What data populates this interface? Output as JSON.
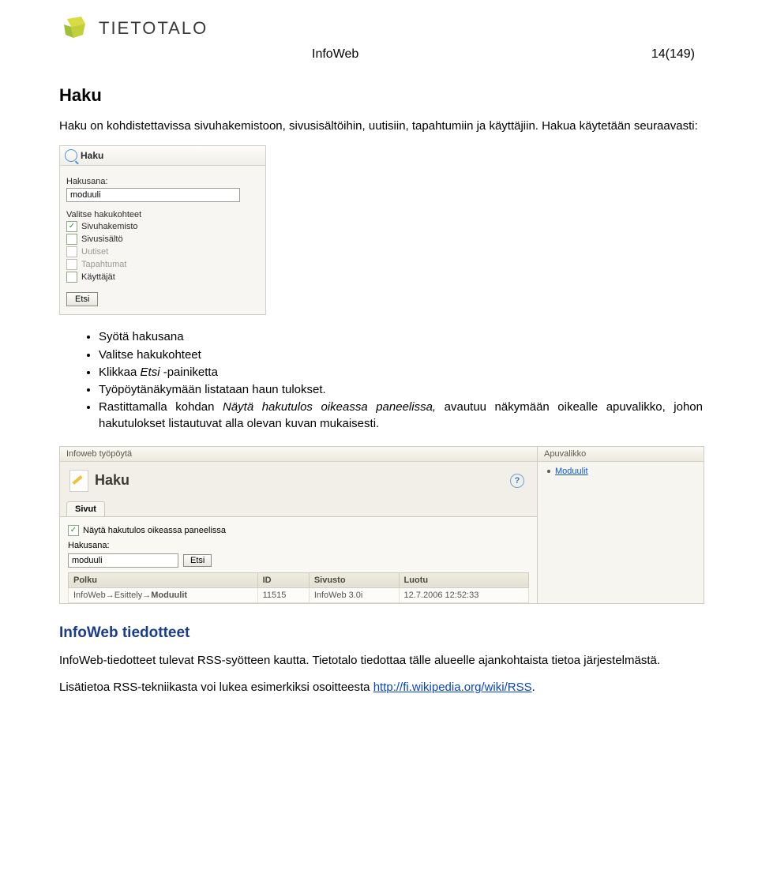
{
  "logo_text": "TIETOTALO",
  "doc_title": "InfoWeb",
  "page_no": "14(149)",
  "h_haku": "Haku",
  "p_intro": "Haku on kohdistettavissa sivuhakemistoon, sivusisältöihin, uutisiin, tapahtumiin ja käyttäjiin. Hakua käytetään seuraavasti:",
  "inset1": {
    "title": "Haku",
    "lbl_hakusana": "Hakusana:",
    "val_hakusana": "moduuli",
    "lbl_valitse": "Valitse hakukohteet",
    "opts": [
      {
        "label": "Sivuhakemisto",
        "checked": true,
        "dim": false
      },
      {
        "label": "Sivusisältö",
        "checked": false,
        "dim": false
      },
      {
        "label": "Uutiset",
        "checked": false,
        "dim": true
      },
      {
        "label": "Tapahtumat",
        "checked": false,
        "dim": true
      },
      {
        "label": "Käyttäjät",
        "checked": false,
        "dim": false
      }
    ],
    "btn_etsi": "Etsi"
  },
  "bullets": {
    "b1": "Syötä hakusana",
    "b2": "Valitse hakukohteet",
    "b3_a": "Klikkaa ",
    "b3_i": "Etsi",
    "b3_b": " -painiketta",
    "b4": "Työpöytänäkymään listataan haun tulokset.",
    "b5_a": "Rastittamalla kohdan ",
    "b5_i": "Näytä hakutulos oikeassa paneelissa,",
    "b5_b": " avautuu näkymään oikealle apuvalikko, johon hakutulokset listautuvat alla olevan kuvan mukaisesti."
  },
  "inset2": {
    "bar_main": "Infoweb työpöytä",
    "bar_side": "Apuvalikko",
    "haku_title": "Haku",
    "tab": "Sivut",
    "chk_label": "Näytä hakutulos oikeassa paneelissa",
    "lbl_hakusana": "Hakusana:",
    "val_hakusana": "moduuli",
    "btn_etsi": "Etsi",
    "cols": {
      "polku": "Polku",
      "id": "ID",
      "sivusto": "Sivusto",
      "luotu": "Luotu"
    },
    "row": {
      "polku_a": "InfoWeb→Esittely→",
      "polku_b": "Moduulit",
      "id": "11515",
      "sivusto": "InfoWeb 3.0i",
      "luotu": "12.7.2006 12:52:33"
    },
    "side_link": "Moduulit"
  },
  "h_tiedotteet": "InfoWeb tiedotteet",
  "p_tied": "InfoWeb-tiedotteet tulevat RSS-syötteen kautta. Tietotalo tiedottaa tälle alueelle ajankohtaista tietoa järjestelmästä.",
  "p_rss_a": "Lisätietoa RSS-tekniikasta voi lukea esimerkiksi osoitteesta ",
  "p_rss_link": "http://fi.wikipedia.org/wiki/RSS",
  "p_rss_b": "."
}
